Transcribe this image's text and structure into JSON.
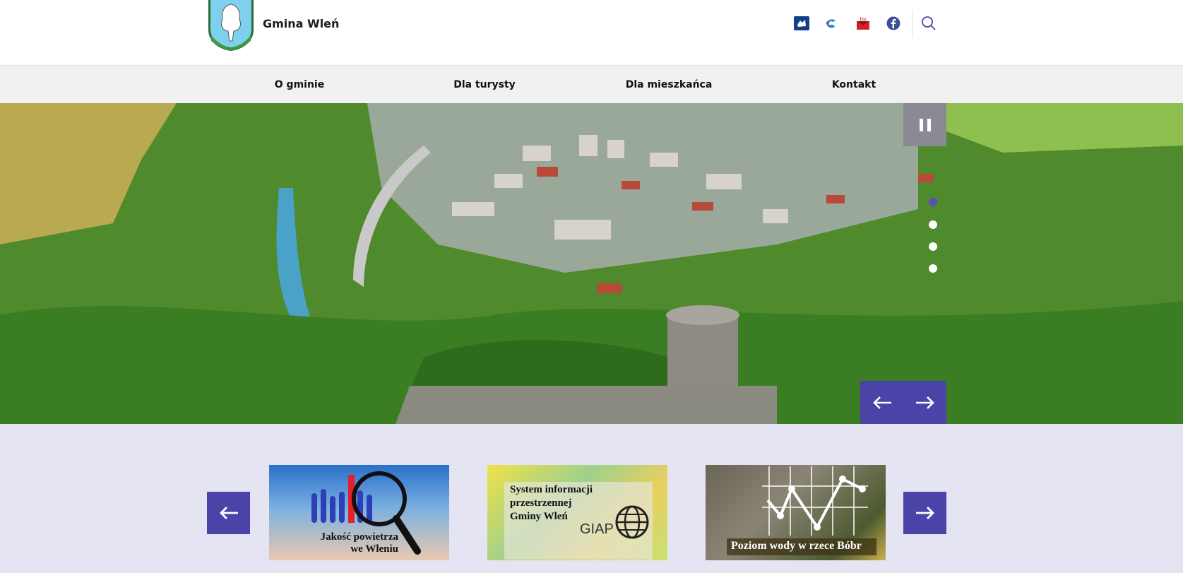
{
  "header": {
    "site_name": "Gmina Wleń",
    "icons": [
      "sign-language-icon",
      "epuap-icon",
      "bip-icon",
      "facebook-icon",
      "search-icon"
    ],
    "bip_label": "bip"
  },
  "nav": {
    "items": [
      {
        "label": "O gminie"
      },
      {
        "label": "Dla turysty"
      },
      {
        "label": "Dla mieszkańca"
      },
      {
        "label": "Kontakt"
      }
    ]
  },
  "hero": {
    "dots_count": 4,
    "active_dot": 0
  },
  "cards": [
    {
      "title_line1": "Jakość powietrza",
      "title_line2": "we Wleniu"
    },
    {
      "title_line1": "System informacji",
      "title_line2": "przestrzennej",
      "title_line3": "Gminy Wleń",
      "badge": "GIAP"
    },
    {
      "title": "Poziom wody w rzece Bóbr"
    }
  ],
  "colors": {
    "accent": "#4c43a8",
    "nav_bg": "#f1f1f1",
    "page_bg": "#e4e4f2",
    "pause_bg": "#8a8a92"
  }
}
